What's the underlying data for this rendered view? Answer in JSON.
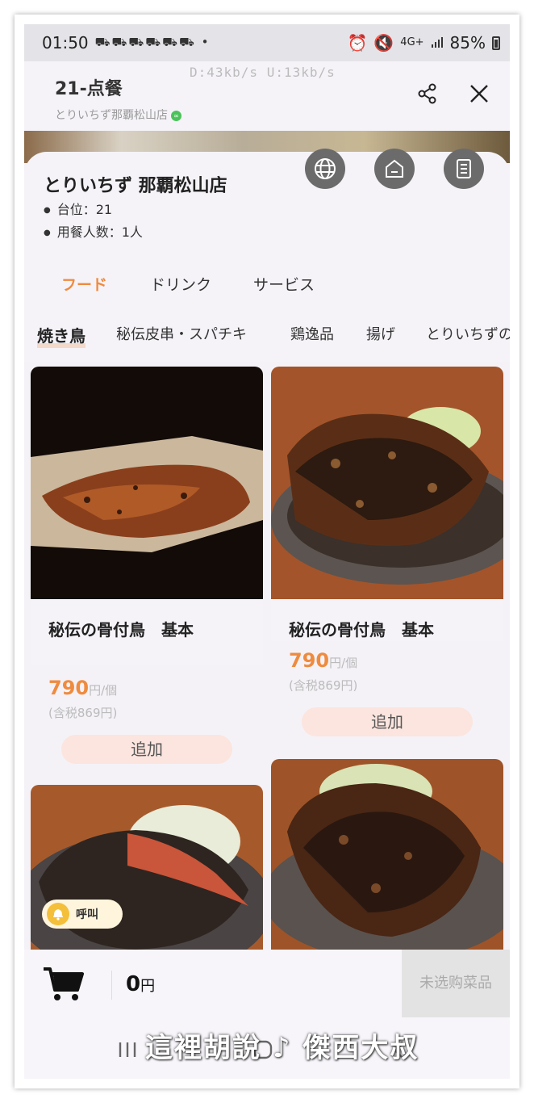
{
  "status_bar": {
    "time": "01:50",
    "notification_icons": "⛟⛟⛟⛟⛟⛟ •",
    "network_top": "4G+",
    "battery": "85%"
  },
  "app_header": {
    "title": "21-点餐",
    "subtitle": "とりいちず那覇松山店",
    "speed_overlay": "D:43kb/s U:13kb/s"
  },
  "store": {
    "name": "とりいちず 那覇松山店",
    "table": "台位：21",
    "guests": "用餐人数：1人"
  },
  "tabs": [
    {
      "label": "フード",
      "active": true
    },
    {
      "label": "ドリンク",
      "active": false
    },
    {
      "label": "サービス",
      "active": false
    }
  ],
  "categories": [
    {
      "label": "焼き鳥",
      "active": true
    },
    {
      "label": "秘伝皮串・スパチキ",
      "active": false
    },
    {
      "label": "鶏逸品",
      "active": false
    },
    {
      "label": "揚げ",
      "active": false
    },
    {
      "label": "とりいちずの",
      "active": false
    }
  ],
  "products": [
    {
      "name": "秘伝の骨付鳥　基本",
      "price": "790",
      "unit": "円/個",
      "taxed": "(含税869円)",
      "add_label": "追加"
    },
    {
      "name": "秘伝の骨付鳥　基本",
      "price": "790",
      "unit": "円/個",
      "taxed": "(含税869円)",
      "add_label": "追加"
    }
  ],
  "call_button": {
    "label": "呼叫"
  },
  "cart": {
    "total": "0",
    "currency": "円",
    "checkout_label": "未选购菜品"
  },
  "watermark": "這裡胡說 ♪ 傑西大叔",
  "colors": {
    "accent": "#f08a3e",
    "add_button_bg": "#fbe5de",
    "checkout_bg": "#e3e3e3"
  }
}
